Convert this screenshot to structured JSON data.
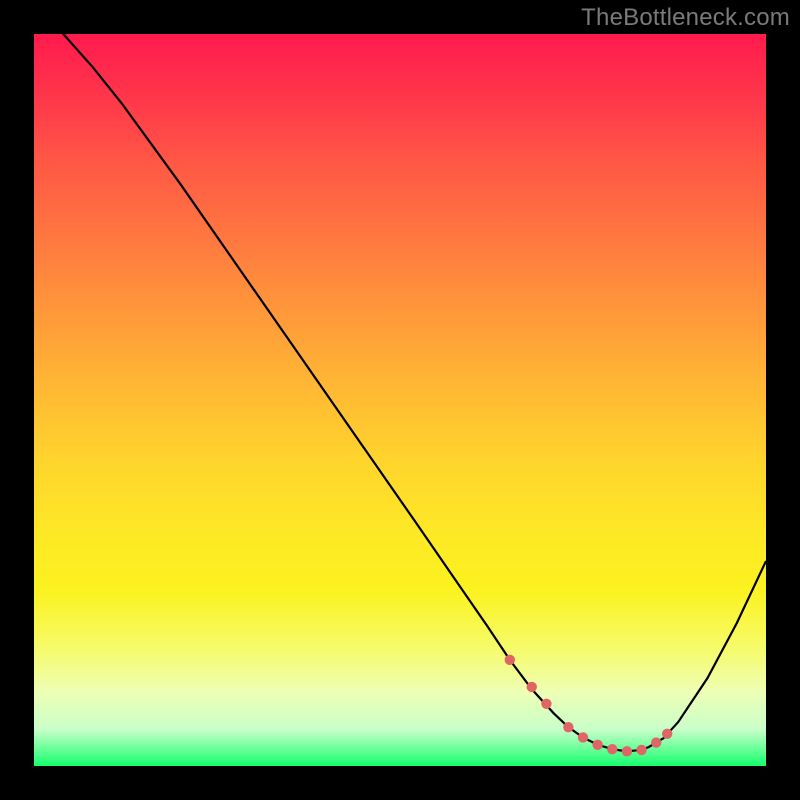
{
  "watermark": "TheBottleneck.com",
  "chart_data": {
    "type": "line",
    "title": "",
    "xlabel": "",
    "ylabel": "",
    "xlim": [
      0,
      100
    ],
    "ylim": [
      0,
      100
    ],
    "series": [
      {
        "name": "curve",
        "x": [
          0,
          4,
          8,
          12,
          20,
          28,
          36,
          44,
          52,
          58,
          62,
          65,
          68,
          71,
          73,
          75,
          77,
          79,
          81,
          83,
          84,
          86,
          88,
          92,
          96,
          100
        ],
        "y": [
          105,
          100,
          95.5,
          90.5,
          79.5,
          68.0,
          56.5,
          45.0,
          33.5,
          24.8,
          19.0,
          14.5,
          10.5,
          7.2,
          5.3,
          3.9,
          2.9,
          2.3,
          2.0,
          2.2,
          2.6,
          3.8,
          6.0,
          12.0,
          19.5,
          28.0
        ]
      }
    ],
    "dots": {
      "name": "highlight",
      "x": [
        65,
        68,
        70,
        73,
        75,
        77,
        79,
        81,
        83,
        85,
        86.5
      ],
      "y": [
        14.5,
        10.8,
        8.5,
        5.3,
        3.9,
        2.9,
        2.3,
        2.0,
        2.2,
        3.2,
        4.4
      ]
    }
  },
  "colors": {
    "dot": "#e06666",
    "line": "#000000"
  }
}
